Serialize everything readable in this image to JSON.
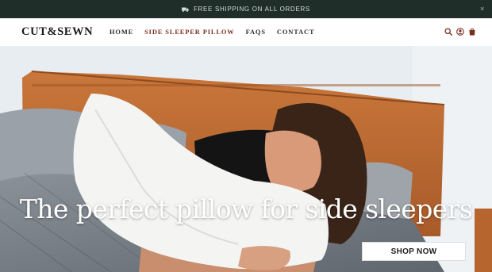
{
  "announcement": {
    "text": "FREE SHIPPING ON ALL ORDERS",
    "icon": "truck-icon",
    "close_label": "×"
  },
  "header": {
    "logo": "CUT&SEWN",
    "nav": [
      {
        "label": "HOME",
        "active": false
      },
      {
        "label": "SIDE SLEEPER PILLOW",
        "active": true
      },
      {
        "label": "FAQS",
        "active": false
      },
      {
        "label": "CONTACT",
        "active": false
      }
    ],
    "icons": [
      "search-icon",
      "account-icon",
      "cart-icon"
    ]
  },
  "hero": {
    "headline": "The perfect pillow for side sleepers",
    "cta_label": "SHOP NOW"
  },
  "colors": {
    "announcement_bg": "#1f2e29",
    "nav_active": "#7a2e1e",
    "headline": "#ffffff"
  }
}
